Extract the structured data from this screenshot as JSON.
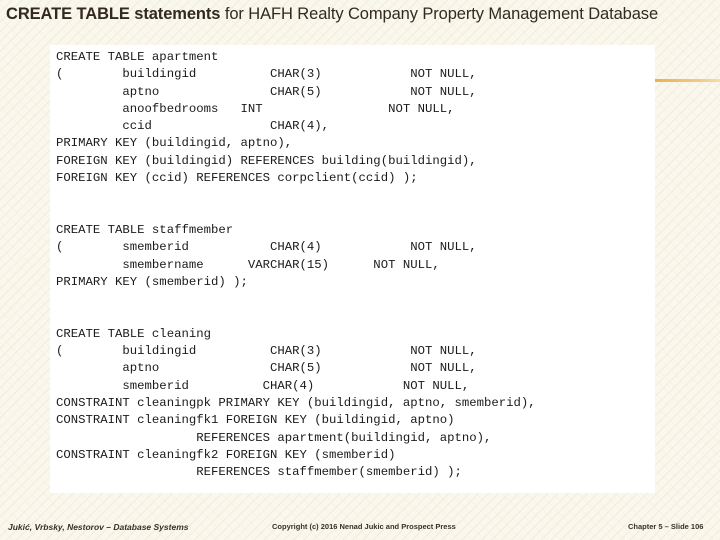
{
  "slide": {
    "title_strong": "CREATE TABLE statements",
    "title_rest": " for HAFH Realty Company Property Management Database",
    "accent_color": "#e8b251",
    "background_color": "#faf7ed",
    "panel_color": "#ffffff",
    "text_color": "#322a20"
  },
  "code": {
    "full_text": "CREATE TABLE apartment\n(        buildingid          CHAR(3)            NOT NULL,\n         aptno               CHAR(5)            NOT NULL,\n         anoofbedrooms   INT                 NOT NULL,\n         ccid                CHAR(4),\nPRIMARY KEY (buildingid, aptno),\nFOREIGN KEY (buildingid) REFERENCES building(buildingid),\nFOREIGN KEY (ccid) REFERENCES corpclient(ccid) );\n\n\nCREATE TABLE staffmember\n(        smemberid           CHAR(4)            NOT NULL,\n         smembername      VARCHAR(15)      NOT NULL,\nPRIMARY KEY (smemberid) );\n\n\nCREATE TABLE cleaning\n(        buildingid          CHAR(3)            NOT NULL,\n         aptno               CHAR(5)            NOT NULL,\n         smemberid          CHAR(4)            NOT NULL,\nCONSTRAINT cleaningpk PRIMARY KEY (buildingid, aptno, smemberid),\nCONSTRAINT cleaningfk1 FOREIGN KEY (buildingid, aptno)\n                   REFERENCES apartment(buildingid, aptno),\nCONSTRAINT cleaningfk2 FOREIGN KEY (smemberid)\n                   REFERENCES staffmember(smemberid) );",
    "statements": [
      {
        "name": "apartment",
        "lines": [
          "CREATE TABLE apartment",
          "(        buildingid          CHAR(3)            NOT NULL,",
          "         aptno               CHAR(5)            NOT NULL,",
          "         anoofbedrooms   INT                 NOT NULL,",
          "         ccid                CHAR(4),",
          "PRIMARY KEY (buildingid, aptno),",
          "FOREIGN KEY (buildingid) REFERENCES building(buildingid),",
          "FOREIGN KEY (ccid) REFERENCES corpclient(ccid) );"
        ]
      },
      {
        "name": "staffmember",
        "lines": [
          "CREATE TABLE staffmember",
          "(        smemberid           CHAR(4)            NOT NULL,",
          "         smembername      VARCHAR(15)      NOT NULL,",
          "PRIMARY KEY (smemberid) );"
        ]
      },
      {
        "name": "cleaning",
        "lines": [
          "CREATE TABLE cleaning",
          "(        buildingid          CHAR(3)            NOT NULL,",
          "         aptno               CHAR(5)            NOT NULL,",
          "         smemberid          CHAR(4)            NOT NULL,",
          "CONSTRAINT cleaningpk PRIMARY KEY (buildingid, aptno, smemberid),",
          "CONSTRAINT cleaningfk1 FOREIGN KEY (buildingid, aptno)",
          "                   REFERENCES apartment(buildingid, aptno),",
          "CONSTRAINT cleaningfk2 FOREIGN KEY (smemberid)",
          "                   REFERENCES staffmember(smemberid) );"
        ]
      }
    ]
  },
  "footer": {
    "left": "Jukić, Vrbsky, Nestorov – Database Systems",
    "center": "Copyright (c) 2016 Nenad Jukic and Prospect Press",
    "right": "Chapter 5 – Slide  106"
  }
}
